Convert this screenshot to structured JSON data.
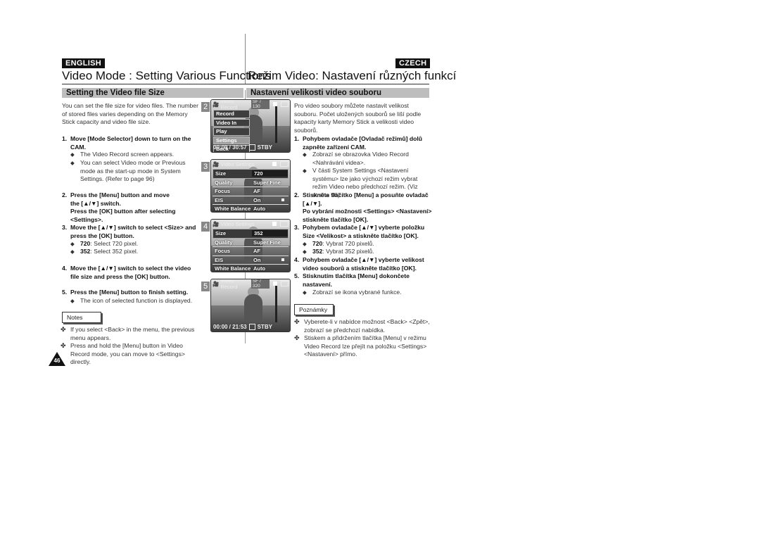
{
  "header": {
    "lang_left": "ENGLISH",
    "lang_right": "CZECH",
    "title_en": "Video Mode : Setting Various Functions",
    "title_cz": "Režim Video: Nastavení různých funkcí",
    "section_en": "Setting the Video file Size",
    "section_cz": "Nastavení velikosti video souboru"
  },
  "english": {
    "intro": "You can set the file size for video files. The number of stored files varies depending on the Memory Stick capacity and video file size.",
    "steps": [
      {
        "num": "1.",
        "text": "Move [Mode Selector] down to turn on the CAM.",
        "bullets": [
          "The Video Record screen appears.",
          "You can select Video mode or Previous mode as the start-up mode in System Settings. (Refer to page 96)"
        ]
      },
      {
        "num": "2.",
        "text": "Press the [Menu] button and move the [▲/▼] switch.",
        "text2": "Press the [OK] button after selecting <Settings>."
      },
      {
        "num": "3.",
        "text": "Move the [▲/▼] switch to select <Size> and press the [OK] button.",
        "bullets": [
          {
            "key": "720",
            "rest": ": Select 720 pixel."
          },
          {
            "key": "352",
            "rest": ": Select 352 pixel."
          }
        ]
      },
      {
        "num": "4.",
        "text": "Move the [▲/▼] switch to select the video file size and press the [OK] button."
      },
      {
        "num": "5.",
        "text": "Press the [Menu] button to finish setting.",
        "bullets": [
          "The icon of selected function is displayed."
        ]
      }
    ],
    "notes_label": "Notes",
    "notes": [
      "If you select <Back> in the menu, the previous menu appears.",
      "Press and hold the [Menu] button in Video Record mode, you can move to <Settings> directly."
    ],
    "page_number": "46"
  },
  "czech": {
    "intro": "Pro video soubory můžete nastavit velikost souboru. Počet uložených souborů se liší podle kapacity karty Memory Stick a velikosti video souborů.",
    "steps": [
      {
        "num": "1.",
        "text": "Pohybem ovladače [Ovladač režimů] dolů zapněte zařízení CAM.",
        "bullets": [
          "Zobrazí se obrazovka Video Record <Nahrávání videa>.",
          "V části System Settings <Nastavení systému> lze jako výchozí režim vybrat režim Video nebo předchozí režim. (Viz strana 96)"
        ]
      },
      {
        "num": "2.",
        "text": "Stiskněte tlačítko [Menu] a posuňte ovladač [▲/▼].",
        "text2": "Po vybrání možnosti <Settings> <Nastavení> stiskněte tlačítko [OK]."
      },
      {
        "num": "3.",
        "text": "Pohybem ovladače [▲/▼] vyberte položku Size <Velikost> a stiskněte tlačítko [OK].",
        "bullets": [
          {
            "key": "720",
            "rest": ": Vybrat 720 pixelů."
          },
          {
            "key": "352",
            "rest": ": Vybrat 352 pixelů."
          }
        ]
      },
      {
        "num": "4.",
        "text": "Pohybem ovladače [▲/▼] vyberte velikost video souborů a stiskněte tlačítko [OK]."
      },
      {
        "num": "5.",
        "text": "Stisknutím tlačítka [Menu] dokončete nastavení.",
        "bullets": [
          "Zobrazí se ikona vybrané funkce."
        ]
      }
    ],
    "notes_label": "Poznámky",
    "notes": [
      "Vyberete-li v nabídce možnost <Back> <Zpět>, zobrazí se předchozí nabídka.",
      "Stiskem a přidržením tlačítka [Menu] v režimu Video Record lze přejít na položku <Settings> <Nastavení> přímo."
    ]
  },
  "screens": [
    {
      "num": "2",
      "title": "Video Record",
      "counter": "SF / 130",
      "menu": [
        "Record",
        "Video In",
        "Play",
        "Settings",
        "Back"
      ],
      "selected": "Settings",
      "time": "00:00 / 30:57",
      "status": "STBY"
    },
    {
      "num": "3",
      "title": "Video Settings",
      "rows": [
        {
          "k": "Size",
          "v": "720"
        },
        {
          "k": "Quality",
          "v": "Super Fine"
        },
        {
          "k": "Focus",
          "v": "AF"
        },
        {
          "k": "EIS",
          "v": "On"
        },
        {
          "k": "White Balance",
          "v": "Auto"
        }
      ]
    },
    {
      "num": "4",
      "title": "Video Settings",
      "rows": [
        {
          "k": "Size",
          "v": "352"
        },
        {
          "k": "Quality",
          "v": "Super Fine"
        },
        {
          "k": "Focus",
          "v": "AF"
        },
        {
          "k": "EIS",
          "v": "On"
        },
        {
          "k": "White Balance",
          "v": "Auto"
        }
      ]
    },
    {
      "num": "5",
      "title": "Video Record",
      "counter": "SF / 320",
      "time": "00:00 / 21:53",
      "status": "STBY"
    }
  ],
  "icons": {
    "bullet": "◆",
    "note": "✤"
  }
}
